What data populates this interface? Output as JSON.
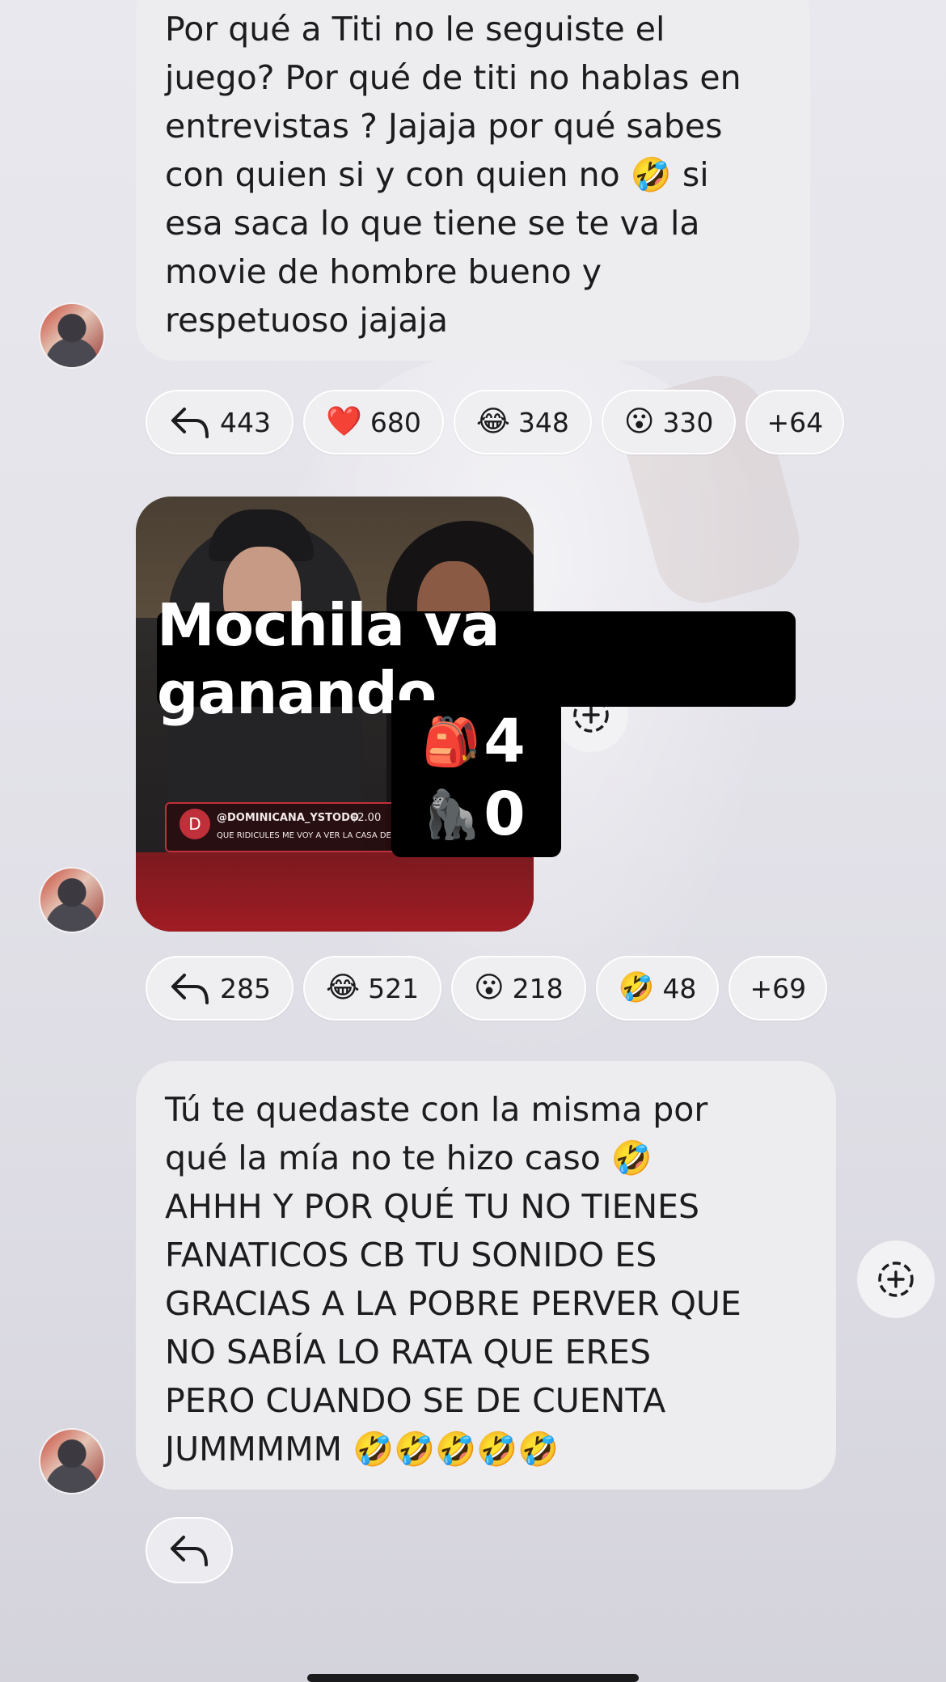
{
  "messages": [
    {
      "text": "Por qué a Titi no le seguiste el juego? Por qué de titi no hablas en entrevistas ? Jajaja por qué sabes con quien si y con quien no 🤣 si esa saca lo que tiene se te va la movie de hombre bueno y respetuoso jajaja",
      "lines": [
        "Por qué a Titi no le seguiste el",
        "juego? Por qué de titi no hablas en",
        "entrevistas ? Jajaja por qué sabes",
        "con quien si y con quien no 🤣 si",
        "esa saca lo que tiene se te va la",
        "movie de hombre bueno y",
        "respetuoso jajaja"
      ],
      "reactions": {
        "replies": "443",
        "items": [
          {
            "emoji": "❤️",
            "count": "680"
          },
          {
            "emoji": "😂",
            "count": "348"
          },
          {
            "emoji": "😮",
            "count": "330"
          }
        ],
        "more": "+64"
      }
    },
    {
      "media": {
        "caption_title": "Mochila va ganando",
        "score_lines": [
          {
            "emoji": "🎒",
            "value": "4"
          },
          {
            "emoji": "🦍",
            "value": "0"
          }
        ],
        "overlay_initial": "D",
        "overlay_handle": "@DOMINICANA_YSTODO",
        "overlay_amount": "$2.00",
        "overlay_comment": "QUE RIDICULES ME VOY A VER LA CASA DE LOS FAMOSOS"
      },
      "reactions": {
        "replies": "285",
        "items": [
          {
            "emoji": "😂",
            "count": "521"
          },
          {
            "emoji": "😮",
            "count": "218"
          },
          {
            "emoji": "🤣",
            "count": "48"
          }
        ],
        "more": "+69"
      }
    },
    {
      "text": "Tú te quedaste con la misma por qué la mía no te hizo caso 🤣 AHHH Y POR QUÉ TU NO TIENES FANATICOS CB TU SONIDO ES GRACIAS A LA POBRE PERVER QUE NO SABÍA LO RATA QUE ERES PERO CUANDO SE DE CUENTA JUMMMMM 🤣🤣🤣🤣🤣",
      "lines": [
        "Tú te quedaste con la misma por",
        "qué la mía no te hizo caso 🤣",
        "AHHH Y POR QUÉ TU NO TIENES",
        "FANATICOS CB TU SONIDO ES",
        "GRACIAS A LA POBRE PERVER QUE",
        "NO SABÍA LO RATA QUE ERES",
        "PERO CUANDO SE DE CUENTA",
        "JUMMMMM 🤣🤣🤣🤣🤣"
      ]
    }
  ],
  "icons": {
    "reply": "reply-arrow-icon",
    "add_reaction": "add-reaction-icon",
    "avatar": "avatar"
  },
  "colors": {
    "bubble": "#ededf0",
    "pill": "#efeff2",
    "caption_bg": "#000000",
    "caption_text": "#ffffff"
  }
}
